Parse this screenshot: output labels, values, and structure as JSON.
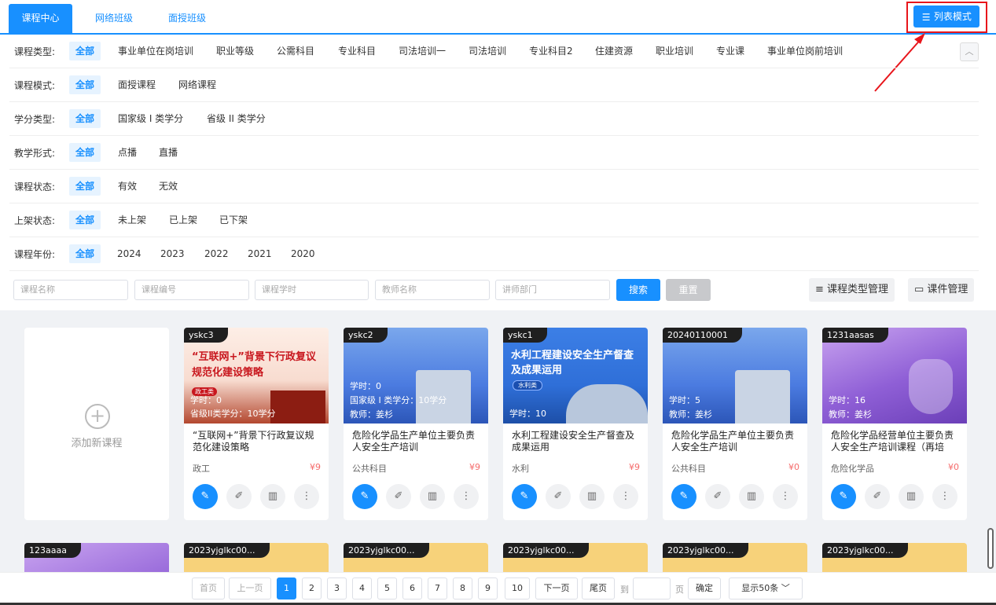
{
  "tabs": [
    {
      "label": "课程中心",
      "active": true
    },
    {
      "label": "网络班级",
      "active": false
    },
    {
      "label": "面授班级",
      "active": false
    }
  ],
  "list_mode_button": {
    "label": "列表模式",
    "icon": "list-icon"
  },
  "filters": [
    {
      "label": "课程类型:",
      "options": [
        "全部",
        "事业单位在岗培训",
        "职业等级",
        "公需科目",
        "专业科目",
        "司法培训一",
        "司法培训",
        "专业科目2",
        "住建资源",
        "职业培训",
        "专业课",
        "事业单位岗前培训"
      ]
    },
    {
      "label": "课程模式:",
      "options": [
        "全部",
        "面授课程",
        "网络课程"
      ]
    },
    {
      "label": "学分类型:",
      "options": [
        "全部",
        "国家级 I 类学分",
        "省级 II 类学分"
      ]
    },
    {
      "label": "教学形式:",
      "options": [
        "全部",
        "点播",
        "直播"
      ]
    },
    {
      "label": "课程状态:",
      "options": [
        "全部",
        "有效",
        "无效"
      ]
    },
    {
      "label": "上架状态:",
      "options": [
        "全部",
        "未上架",
        "已上架",
        "已下架"
      ]
    },
    {
      "label": "课程年份:",
      "options": [
        "全部",
        "2024",
        "2023",
        "2022",
        "2021",
        "2020"
      ]
    }
  ],
  "search": {
    "placeholders": [
      "课程名称",
      "课程编号",
      "课程学时",
      "教师名称",
      "讲师部门"
    ],
    "search_label": "搜索",
    "reset_label": "重置",
    "type_manage_label": "课程类型管理",
    "courseware_label": "课件管理"
  },
  "add_card": {
    "label": "添加新课程"
  },
  "courses": [
    {
      "code": "yskc3",
      "banner_title_1": "“互联网+”背景下行政复议",
      "banner_title_2": "规范化建设策略",
      "banner_tag": "政工类",
      "img_lines": [
        "学时：0",
        "省级II类学分：10学分"
      ],
      "title": "“互联网+”背景下行政复议规范化建设策略",
      "category": "政工",
      "price": "¥9",
      "theme": "red"
    },
    {
      "code": "yskc2",
      "img_lines": [
        "学时：0",
        "国家级 I 类学分：10学分",
        "教师：姜杉"
      ],
      "title": "危险化学品生产单位主要负责人安全生产培训",
      "category": "公共科目",
      "price": "¥9",
      "theme": "blue"
    },
    {
      "code": "yskc1",
      "banner_title_1": "水利工程建设安全生产督查",
      "banner_title_2": "及成果运用",
      "banner_tag": "水利类",
      "img_lines": [
        "学时：10"
      ],
      "title": "水利工程建设安全生产督查及成果运用",
      "category": "水利",
      "price": "¥9",
      "theme": "blue2"
    },
    {
      "code": "20240110001",
      "img_lines": [
        "学时：5",
        "教师：姜杉"
      ],
      "title": "危险化学品生产单位主要负责人安全生产培训",
      "category": "公共科目",
      "price": "¥0",
      "theme": "blue"
    },
    {
      "code": "1231aasas",
      "img_lines": [
        "学时：16",
        "教师：姜杉"
      ],
      "title": "危险化学品经营单位主要负责人安全生产培训课程（再培",
      "category": "危险化学品",
      "price": "¥0",
      "theme": "purple"
    }
  ],
  "row2_codes": [
    "123aaaa",
    "2023yjglkc00...",
    "2023yjglkc00...",
    "2023yjglkc00...",
    "2023yjglkc00...",
    "2023yjglkc00..."
  ],
  "pagination": {
    "first": "首页",
    "prev": "上一页",
    "pages": [
      "1",
      "2",
      "3",
      "4",
      "5",
      "6",
      "7",
      "8",
      "9",
      "10"
    ],
    "current": "1",
    "next": "下一页",
    "last": "尾页",
    "goto_prefix": "到",
    "goto_suffix": "页",
    "confirm": "确定",
    "page_size": "显示50条"
  },
  "colors": {
    "accent": "#1890ff",
    "price": "#f56c6c",
    "highlight_box": "#e8151b"
  }
}
